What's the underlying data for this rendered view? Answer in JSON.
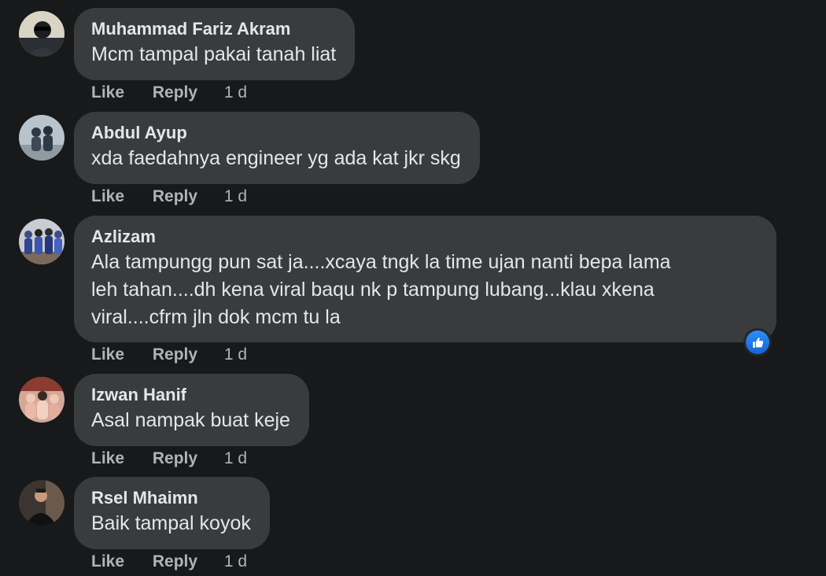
{
  "comments": [
    {
      "author": "Muhammad Fariz Akram",
      "text": "Mcm tampal pakai tanah liat",
      "like_label": "Like",
      "reply_label": "Reply",
      "time": "1 d",
      "avatar_icon": "user-avatar-icon"
    },
    {
      "author": "Abdul Ayup",
      "text": "xda faedahnya engineer yg ada kat jkr skg",
      "like_label": "Like",
      "reply_label": "Reply",
      "time": "1 d",
      "avatar_icon": "user-avatar-icon"
    },
    {
      "author": "Azlizam",
      "text": "Ala tampungg pun sat ja....xcaya tngk la time ujan nanti bepa lama\nleh tahan....dh kena viral baqu nk p tampung lubang...klau xkena\nviral....cfrm jln dok mcm tu la",
      "like_label": "Like",
      "reply_label": "Reply",
      "time": "1 d",
      "avatar_icon": "user-avatar-icon",
      "reaction_icon": "thumbs-up-icon"
    },
    {
      "author": "Izwan Hanif",
      "text": "Asal nampak buat keje",
      "like_label": "Like",
      "reply_label": "Reply",
      "time": "1 d",
      "avatar_icon": "user-avatar-icon"
    },
    {
      "author": "Rsel Mhaimn",
      "text": "Baik tampal koyok",
      "like_label": "Like",
      "reply_label": "Reply",
      "time": "1 d",
      "avatar_icon": "user-avatar-icon"
    }
  ],
  "colors": {
    "background": "#18191a",
    "bubble": "#3a3b3c",
    "primary_text": "#e4e6eb",
    "secondary_text": "#b0b3b8",
    "like_reaction": "#2d8df6"
  }
}
